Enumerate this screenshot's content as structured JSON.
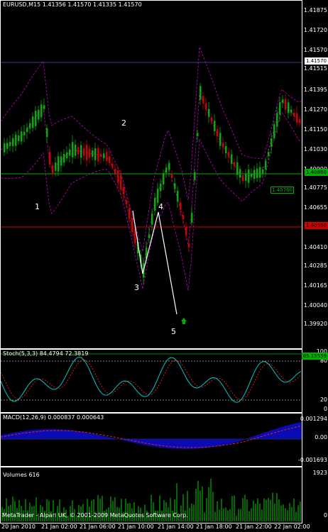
{
  "header": {
    "title": "EURUSD,M15  1.41356 1.41570 1.41335 1.41570"
  },
  "price_axis": [
    "1.41875",
    "1.41720",
    "1.41570",
    "1.41515",
    "1.41395",
    "1.41270",
    "1.41150",
    "1.41030",
    "1.40900",
    "1.40775",
    "1.40655",
    "1.40530",
    "1.40410",
    "1.40285",
    "1.40165",
    "1.40040",
    "1.39920"
  ],
  "price_tags": {
    "current": "1.41570",
    "green": "1.40860",
    "box": "1.40760",
    "red": "1.40550"
  },
  "waves": [
    "1",
    "2",
    "3",
    "4",
    "5"
  ],
  "stoch": {
    "title": "Stoch(5,3,3) 84.4794 72.3819",
    "axis": [
      "100",
      "80",
      "20",
      "0"
    ],
    "tag": "85.15559"
  },
  "macd": {
    "title": "MACD(12,26,9) 0.000837 0.000643",
    "axis": [
      "0.001294",
      "0.00",
      "-0.001693"
    ]
  },
  "volumes": {
    "title": "Volumes 616",
    "axis": [
      "1923",
      "0"
    ]
  },
  "copyright": "MetaTrader - Alpari UK, © 2001-2009 MetaQuotes Software Corp.",
  "time_axis": [
    "20 Jan 2010",
    "21 Jan 02:00",
    "21 Jan 06:00",
    "21 Jan 10:00",
    "21 Jan 14:00",
    "21 Jan 18:00",
    "21 Jan 22:00",
    "22 Jan 02:00"
  ],
  "colors": {
    "bull": "#00b000",
    "bear": "#d00000",
    "band": "#c000c0",
    "stoch_main": "#00c8c8",
    "stoch_signal": "#ff2020",
    "macd_hist": "#1010ff",
    "macd_signal": "#ff2020",
    "volume": "#00b000"
  }
}
